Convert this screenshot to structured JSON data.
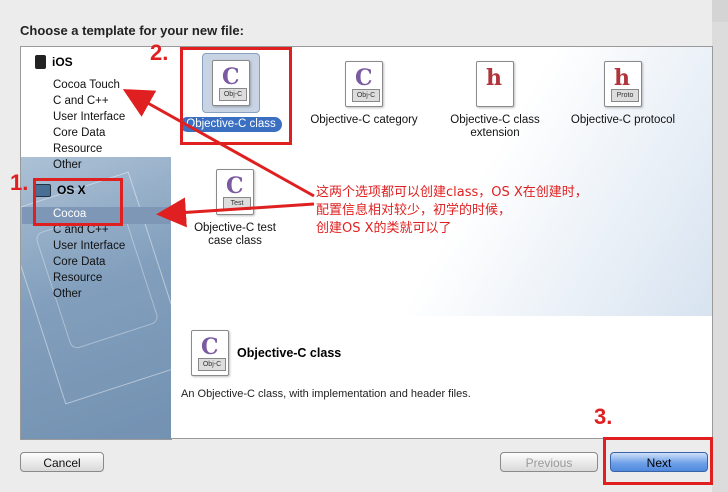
{
  "prompt": "Choose a template for your new file:",
  "sidebar": {
    "ios_title": "iOS",
    "ios_items": [
      "Cocoa Touch",
      "C and C++",
      "User Interface",
      "Core Data",
      "Resource",
      "Other"
    ],
    "osx_title": "OS X",
    "osx_items": [
      "Cocoa",
      "C and C++",
      "User Interface",
      "Core Data",
      "Resource",
      "Other"
    ],
    "selected": "Cocoa"
  },
  "templates": [
    {
      "label": "Objective-C class",
      "tag": "Obj-C",
      "glyph": "C",
      "selected": true
    },
    {
      "label": "Objective-C category",
      "tag": "Obj-C",
      "glyph": "C",
      "selected": false
    },
    {
      "label": "Objective-C class extension",
      "tag": "",
      "glyph": "h",
      "selected": false
    },
    {
      "label": "Objective-C protocol",
      "tag": "Proto",
      "glyph": "h",
      "selected": false
    },
    {
      "label": "Objective-C test case class",
      "tag": "Test",
      "glyph": "C",
      "selected": false
    }
  ],
  "detail": {
    "icon_tag": "Obj-C",
    "title": "Objective-C class",
    "description": "An Objective-C class, with implementation and header files."
  },
  "buttons": {
    "cancel": "Cancel",
    "previous": "Previous",
    "next": "Next"
  },
  "annotations": {
    "step1": "1.",
    "step2": "2.",
    "step3": "3.",
    "note_lines": [
      "这两个选项都可以创建class，OS X在创建时，",
      "配置信息相对较少，初学的时候，",
      "创建OS X的类就可以了"
    ],
    "color": "#e02020"
  }
}
